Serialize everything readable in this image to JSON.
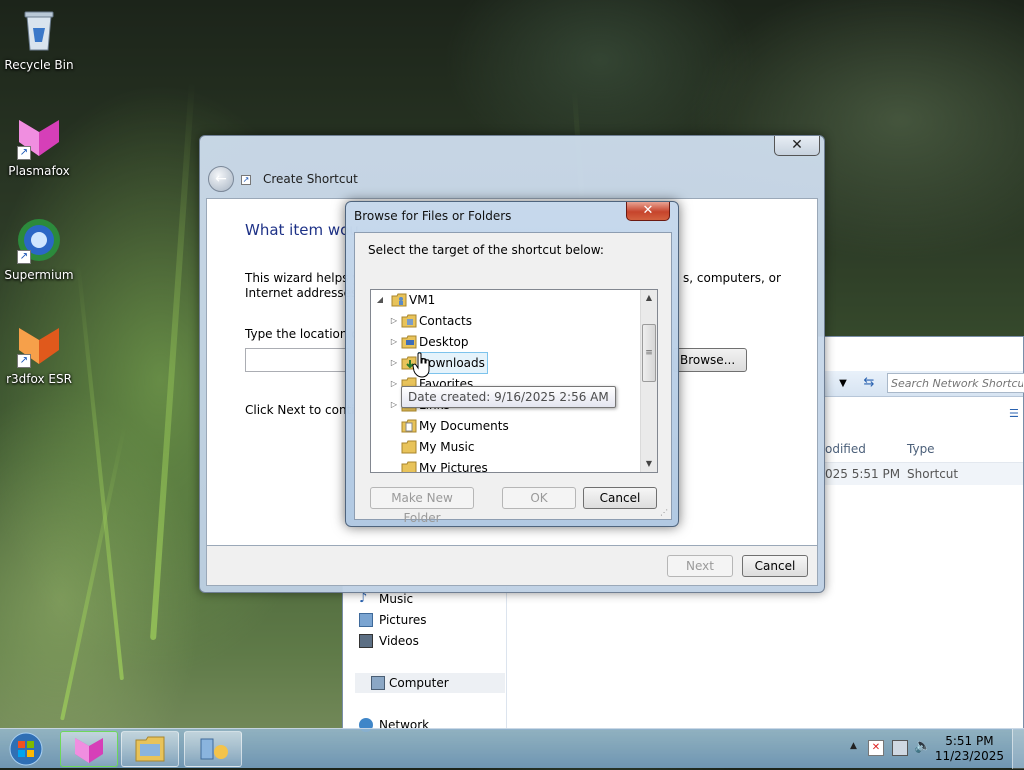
{
  "desktop": {
    "icons": [
      {
        "label": "Recycle Bin",
        "icon": "recycle-bin-icon"
      },
      {
        "label": "Plasmafox",
        "icon": "plasmafox-icon"
      },
      {
        "label": "Supermium",
        "icon": "supermium-icon"
      },
      {
        "label": "r3dfox ESR",
        "icon": "r3dfox-icon"
      }
    ]
  },
  "explorer": {
    "search_placeholder": "Search Network Shortcuts",
    "columns": {
      "modified": "odified",
      "type": "Type"
    },
    "row": {
      "modified": "025 5:51 PM",
      "type": "Shortcut"
    },
    "nav": {
      "music": "Music",
      "pictures": "Pictures",
      "videos": "Videos",
      "computer": "Computer",
      "network": "Network"
    }
  },
  "wizard": {
    "title": "Create Shortcut",
    "close": "✕",
    "heading": "What item wou",
    "intro_left": "This wizard helps y\nInternet addresses.",
    "intro_right": "s, computers, or",
    "location_label": "Type the location o",
    "browse_label": "Browse...",
    "next_hint": "Click Next to contin",
    "next_label": "Next",
    "cancel_label": "Cancel"
  },
  "browse_dialog": {
    "title": "Browse for Files or Folders",
    "close": "✕",
    "prompt": "Select the target of the shortcut below:",
    "tree": {
      "root": "VM1",
      "items": [
        "Contacts",
        "Desktop",
        "Downloads",
        "Favorites",
        "Links",
        "My Documents",
        "My Music",
        "My Pictures"
      ]
    },
    "tooltip": "Date created: 9/16/2025 2:56 AM",
    "make_new_folder": "Make New Folder",
    "ok": "OK",
    "cancel": "Cancel"
  },
  "taskbar": {
    "time": "5:51 PM",
    "date": "11/23/2025"
  },
  "colors": {
    "heading_blue": "#1e3287",
    "close_red": "#c6442c",
    "hover_blue": "#e5f3fb"
  }
}
